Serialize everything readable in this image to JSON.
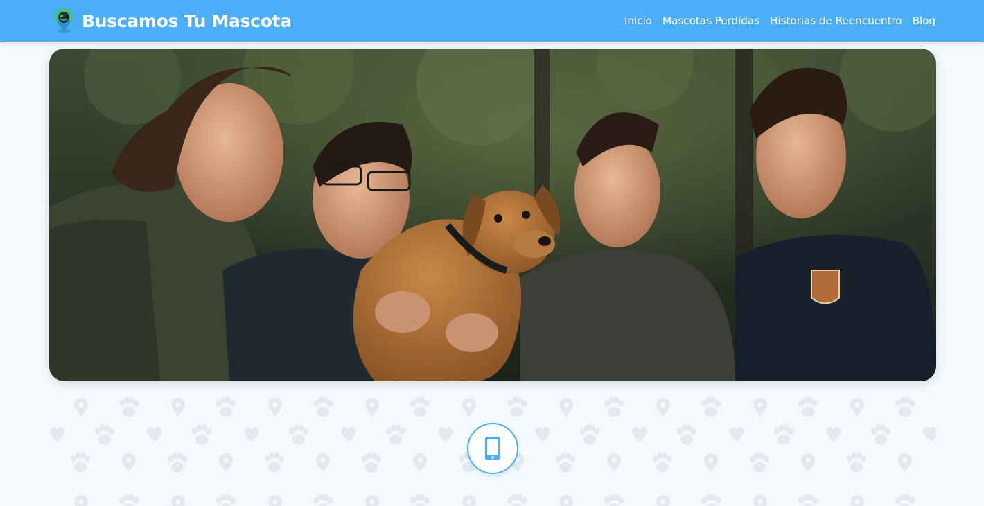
{
  "brand": {
    "name": "Buscamos Tu Mascota",
    "logo_icon": "pet-location-pin-icon"
  },
  "nav": {
    "items": [
      {
        "label": "Inicio"
      },
      {
        "label": "Mascotas Perdidas"
      },
      {
        "label": "Historias de Reencuentro"
      },
      {
        "label": "Blog"
      }
    ]
  },
  "hero": {
    "image_subject": "people-with-found-dog-photo"
  },
  "feature": {
    "icon": "smartphone-icon"
  },
  "colors": {
    "primary": "#4aaef8",
    "background": "#f4f9fe",
    "pattern": "#e6ebf1"
  }
}
